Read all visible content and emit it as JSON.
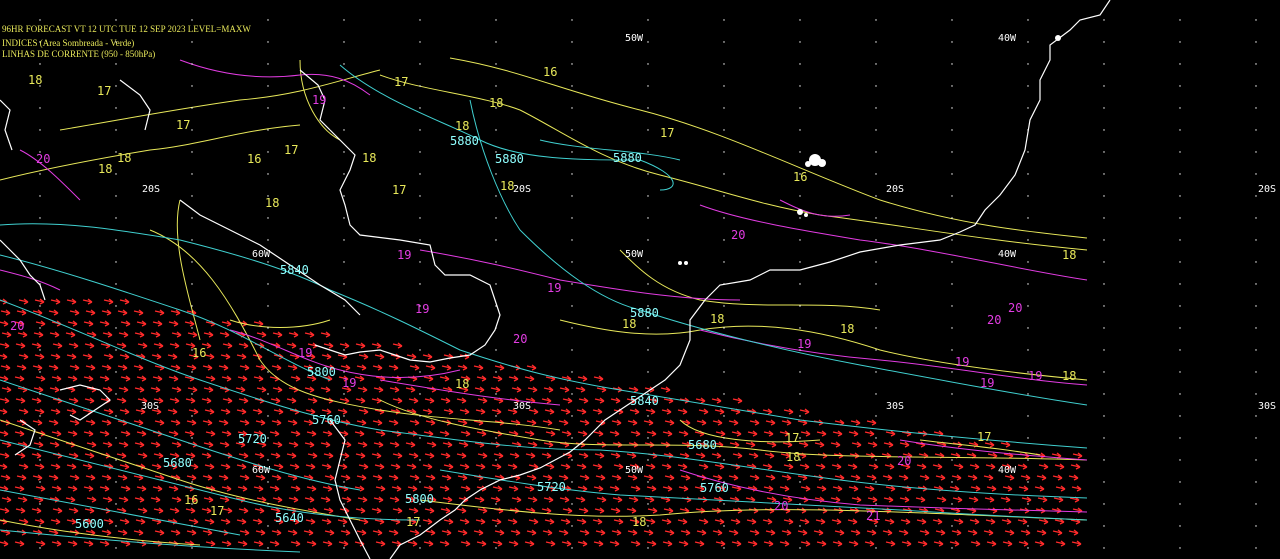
{
  "header": {
    "title": "96HR FORECAST    VT 12 UTC TUE 12 SEP 2023    LEVEL=MAXW",
    "line2": "INDICES (Area Sombreada - Verde)",
    "line3": "LINHAS DE CORRENTE (950 - 850hPa)"
  },
  "colors": {
    "background": "#000000",
    "coastline": "#ffffff",
    "geopotential": "#40d0d0",
    "yellow_field": "#e8e85a",
    "magenta_field": "#e23ce2",
    "wind_arrows": "#ff2a2a"
  },
  "grid_labels": {
    "lon_top": [
      "50W",
      "40W"
    ],
    "lat_20": [
      "20S",
      "20S",
      "20S",
      "20S"
    ],
    "lon_mid": [
      "60W",
      "50W",
      "40W"
    ],
    "lat_30": [
      "30S",
      "30S",
      "30S",
      "30S"
    ],
    "lon_low": [
      "60W",
      "50W",
      "40W"
    ]
  },
  "geopotential_labels": [
    "5880",
    "5880",
    "5880",
    "5840",
    "5880",
    "5800",
    "5840",
    "5760",
    "5720",
    "5680",
    "5800",
    "5760",
    "5720",
    "5640",
    "5680",
    "5600"
  ],
  "yellow_labels": [
    "16",
    "18",
    "17",
    "17",
    "16",
    "18",
    "18",
    "17",
    "18",
    "18",
    "18",
    "17",
    "16",
    "17",
    "18",
    "18",
    "18",
    "17",
    "18",
    "18",
    "18",
    "17",
    "16",
    "18",
    "18",
    "18",
    "17",
    "18",
    "16",
    "17",
    "17"
  ],
  "magenta_labels": [
    "19",
    "19",
    "20",
    "19",
    "19",
    "19",
    "20",
    "19",
    "19",
    "20",
    "20",
    "19",
    "19",
    "19",
    "20",
    "20",
    "20",
    "21",
    "20"
  ]
}
